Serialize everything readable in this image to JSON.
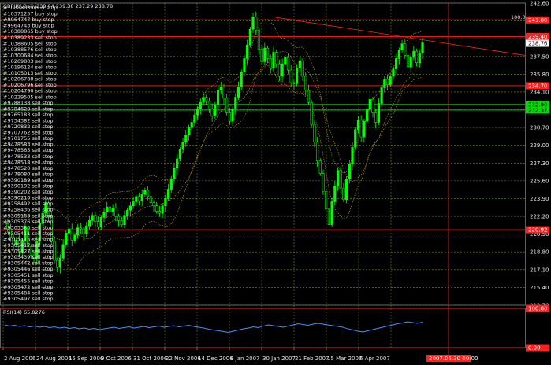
{
  "header": {
    "title": "GBPJPY,Daily",
    "ohlc": "238.04 239.38 237.29 238.78"
  },
  "price_axis": {
    "ticks": [
      "242.60",
      "240.90",
      "239.20",
      "237.50",
      "235.80",
      "234.10",
      "232.40",
      "230.70",
      "229.00",
      "227.30",
      "225.60",
      "223.90",
      "222.20",
      "220.50",
      "218.80",
      "217.10",
      "215.40",
      "213.70"
    ],
    "current_price": "238.76"
  },
  "level_tags": [
    {
      "price": 241.0,
      "text": "241.00",
      "color": "#ff2020"
    },
    {
      "price": 239.4,
      "text": "239.40",
      "color": "#ff2020"
    },
    {
      "price": 234.7,
      "text": "234.70",
      "color": "#ff2020"
    },
    {
      "price": 232.9,
      "text": "232.90",
      "color": "#00e000"
    },
    {
      "price": 232.37,
      "text": "232.37",
      "color": "#00e000"
    },
    {
      "price": 220.92,
      "text": "220.92",
      "color": "#ff2020"
    }
  ],
  "zoom_label": "100.0",
  "orders": [
    {
      "text": "#10388039 buy stop"
    },
    {
      "text": "#10371257 buy stop"
    },
    {
      "text": "#9964747 buy stop"
    },
    {
      "text": "#9964743 buy stop"
    },
    {
      "text": "#10388865 buy stop"
    },
    {
      "text": "#10389233 sell stop"
    },
    {
      "text": "#10388605 sell stop"
    },
    {
      "text": "#10388576 sell stop"
    },
    {
      "text": "#10300684 sell stop"
    },
    {
      "text": "#10269803 sell stop"
    },
    {
      "text": "#10196124 sell stop"
    },
    {
      "text": "#10105013 sell stop"
    },
    {
      "text": "#10206788 sell stop"
    },
    {
      "text": "#10206796 sell stop"
    },
    {
      "text": "#10204790 sell stop"
    },
    {
      "text": "#10229505 sell stop"
    },
    {
      "text": "#9788138 sell stop"
    },
    {
      "text": "#9784620 sell stop"
    },
    {
      "text": "#9765183 sell stop"
    },
    {
      "text": "#9734382 sell stop"
    },
    {
      "text": "#9720832 sell stop"
    },
    {
      "text": "#9707762 sell stop"
    },
    {
      "text": "#9701755 sell stop"
    },
    {
      "text": "#9478583 sell stop"
    },
    {
      "text": "#9478565 sell stop"
    },
    {
      "text": "#9478533 sell stop"
    },
    {
      "text": "#9478518 sell stop"
    },
    {
      "text": "#9478520 sell stop"
    },
    {
      "text": "#9478080 sell stop"
    },
    {
      "text": "#9390189 sell stop"
    },
    {
      "text": "#9390192 sell stop"
    },
    {
      "text": "#9390202 sell stop"
    },
    {
      "text": "#9390210 sell stop"
    },
    {
      "text": "#9258492 sell stop"
    },
    {
      "text": "#9258436 sell stop"
    },
    {
      "text": "#9305163 sell stop"
    },
    {
      "text": "#9305376 sell stop"
    },
    {
      "text": "#9305383 sell stop"
    },
    {
      "text": "#9305411 sell stop"
    },
    {
      "text": "#9305415 sell stop"
    },
    {
      "text": "#9305417 sell stop"
    },
    {
      "text": "#9305427 sell stop"
    },
    {
      "text": "#9305439 sell stop"
    },
    {
      "text": "#9305442 sell stop"
    },
    {
      "text": "#9305446 sell stop"
    },
    {
      "text": "#9305451 sell stop"
    },
    {
      "text": "#9305455 sell stop"
    },
    {
      "text": "#9305472 sell stop"
    },
    {
      "text": "#9305484 sell stop"
    },
    {
      "text": "#9305497 sell stop"
    }
  ],
  "rsi": {
    "title": "RSI(14) 65.8276",
    "tags": [
      {
        "text": "100.00",
        "value": 100
      },
      {
        "text": "0.00",
        "value": 0
      }
    ],
    "values": [
      58,
      55,
      57,
      54,
      56,
      53,
      55,
      52,
      54,
      51,
      53,
      50,
      52,
      49,
      51,
      48,
      50,
      47,
      49,
      46,
      48,
      50,
      52,
      49,
      51,
      53,
      50,
      52,
      54,
      51,
      53,
      55,
      52,
      54,
      56,
      53,
      55,
      57,
      54,
      52,
      50,
      47,
      45,
      43,
      41,
      39,
      42,
      45,
      48,
      50,
      53,
      51,
      55,
      58,
      56,
      54,
      52,
      55,
      58,
      61,
      59,
      57,
      60,
      62,
      60,
      58,
      56,
      54,
      52,
      48,
      45,
      42,
      40,
      43,
      46,
      49,
      52,
      55,
      58,
      61,
      63,
      66,
      64,
      62,
      65
    ]
  },
  "time_axis": {
    "labels": [
      "2 Aug 2006",
      "24 Aug 2006",
      "15 Sep 2006",
      "9 Oct 2006",
      "31 Oct 2006",
      "22 Nov 2006",
      "14 Dec 2006",
      "8 Jan 2007",
      "30 Jan 2007",
      "21 Feb 2007",
      "15 Mar 2007",
      "6 Apr 2007"
    ],
    "crosshair_tag": "2007.05.30 00:00"
  },
  "colors": {
    "bull": "#00ff00",
    "bear": "#00c000",
    "grid": "#6b8e23",
    "resistance": "#ff2020",
    "support": "#00e000",
    "ma": "#c8a000",
    "rsi": "#4a90ff"
  },
  "price_path": [
    221.5,
    221.0,
    220.2,
    219.5,
    219.9,
    218.8,
    219.8,
    221.2,
    219.3,
    218.5,
    218.2,
    219.8,
    221.5,
    222.5,
    223.5,
    222.2,
    219.8,
    218.0,
    217.3,
    218.2,
    219.5,
    220.6,
    221.0,
    219.9,
    220.4,
    221.1,
    221.0,
    220.5,
    221.3,
    221.8,
    222.3,
    221.7,
    221.2,
    222.1,
    222.6,
    223.1,
    222.6,
    223.0,
    222.2,
    221.8,
    221.4,
    222.3,
    222.8,
    223.2,
    223.6,
    224.1,
    223.7,
    224.3,
    224.7,
    224.1,
    223.5,
    223.2,
    222.7,
    222.5,
    223.2,
    223.9,
    224.8,
    225.8,
    226.8,
    227.7,
    228.6,
    229.3,
    230.0,
    230.7,
    231.2,
    231.9,
    232.5,
    233.1,
    233.6,
    233.2,
    232.5,
    231.8,
    232.9,
    234.3,
    234.6,
    233.5,
    232.1,
    231.3,
    232.5,
    233.6,
    234.6,
    236.0,
    237.3,
    238.6,
    240.1,
    241.3,
    240.0,
    238.2,
    237.0,
    238.3,
    237.3,
    236.4,
    237.9,
    236.8,
    235.6,
    236.8,
    237.4,
    236.2,
    235.0,
    234.9,
    236.4,
    237.1,
    235.6,
    234.3,
    233.1,
    231.0,
    229.3,
    227.5,
    226.3,
    224.6,
    222.9,
    221.4,
    223.6,
    225.1,
    226.6,
    224.9,
    223.8,
    225.8,
    227.2,
    228.8,
    230.5,
    231.4,
    229.8,
    231.3,
    232.5,
    233.4,
    232.1,
    231.2,
    233.0,
    234.5,
    235.3,
    234.8,
    235.6,
    236.3,
    237.3,
    238.1,
    238.7,
    237.6,
    236.5,
    237.4,
    238.0,
    236.9,
    237.8,
    238.8
  ]
}
